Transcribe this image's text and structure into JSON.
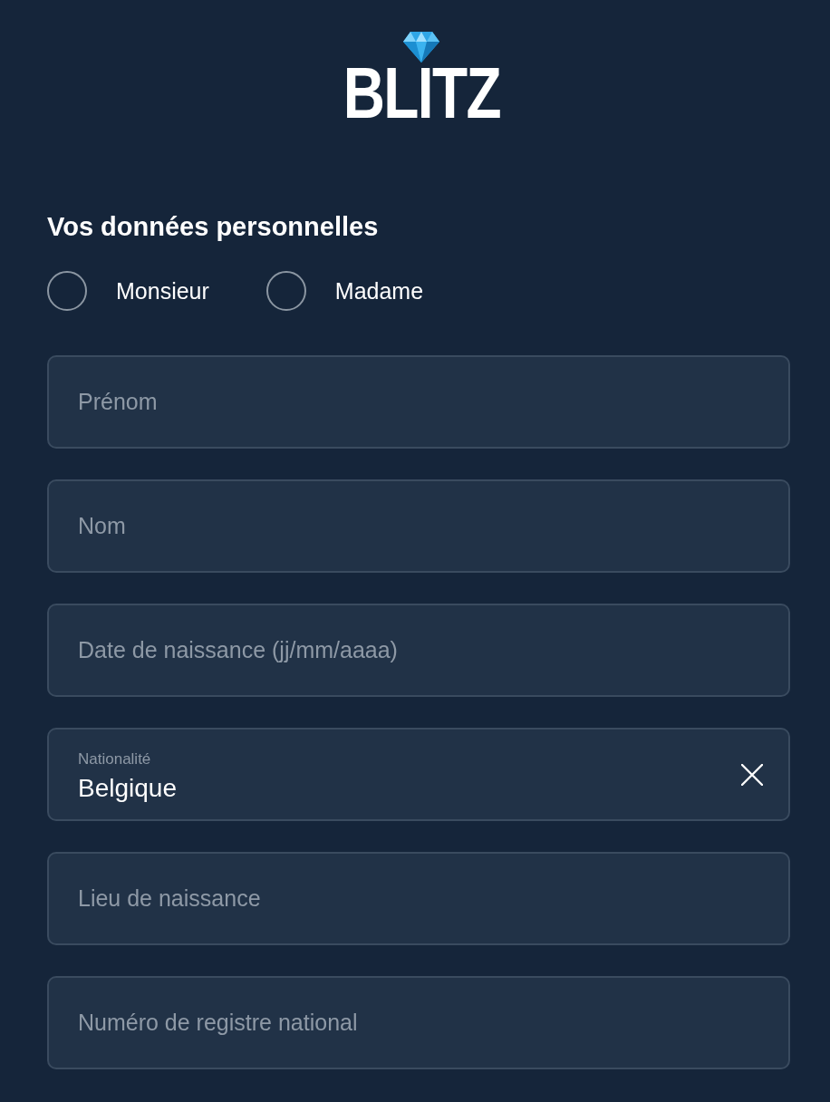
{
  "logo": {
    "text": "BLITZ"
  },
  "section": {
    "title": "Vos données personnelles"
  },
  "gender_options": [
    {
      "label": "Monsieur",
      "selected": false
    },
    {
      "label": "Madame",
      "selected": false
    }
  ],
  "fields": [
    {
      "kind": "text",
      "placeholder": "Prénom"
    },
    {
      "kind": "text",
      "placeholder": "Nom"
    },
    {
      "kind": "text",
      "placeholder": "Date de naissance (jj/mm/aaaa)"
    },
    {
      "kind": "select",
      "label": "Nationalité",
      "value": "Belgique"
    },
    {
      "kind": "text",
      "placeholder": "Lieu de naissance"
    },
    {
      "kind": "text",
      "placeholder": "Numéro de registre national"
    }
  ]
}
